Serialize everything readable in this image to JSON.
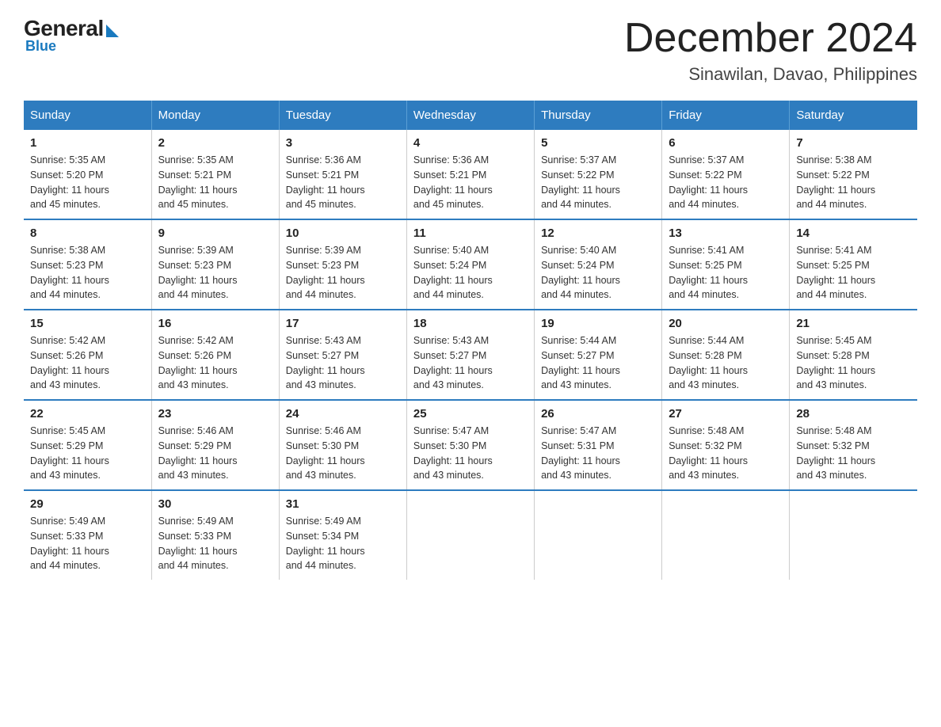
{
  "logo": {
    "general": "General",
    "blue": "Blue"
  },
  "header": {
    "month": "December 2024",
    "location": "Sinawilan, Davao, Philippines"
  },
  "weekdays": [
    "Sunday",
    "Monday",
    "Tuesday",
    "Wednesday",
    "Thursday",
    "Friday",
    "Saturday"
  ],
  "weeks": [
    [
      {
        "day": "1",
        "sunrise": "5:35 AM",
        "sunset": "5:20 PM",
        "daylight": "11 hours and 45 minutes."
      },
      {
        "day": "2",
        "sunrise": "5:35 AM",
        "sunset": "5:21 PM",
        "daylight": "11 hours and 45 minutes."
      },
      {
        "day": "3",
        "sunrise": "5:36 AM",
        "sunset": "5:21 PM",
        "daylight": "11 hours and 45 minutes."
      },
      {
        "day": "4",
        "sunrise": "5:36 AM",
        "sunset": "5:21 PM",
        "daylight": "11 hours and 45 minutes."
      },
      {
        "day": "5",
        "sunrise": "5:37 AM",
        "sunset": "5:22 PM",
        "daylight": "11 hours and 44 minutes."
      },
      {
        "day": "6",
        "sunrise": "5:37 AM",
        "sunset": "5:22 PM",
        "daylight": "11 hours and 44 minutes."
      },
      {
        "day": "7",
        "sunrise": "5:38 AM",
        "sunset": "5:22 PM",
        "daylight": "11 hours and 44 minutes."
      }
    ],
    [
      {
        "day": "8",
        "sunrise": "5:38 AM",
        "sunset": "5:23 PM",
        "daylight": "11 hours and 44 minutes."
      },
      {
        "day": "9",
        "sunrise": "5:39 AM",
        "sunset": "5:23 PM",
        "daylight": "11 hours and 44 minutes."
      },
      {
        "day": "10",
        "sunrise": "5:39 AM",
        "sunset": "5:23 PM",
        "daylight": "11 hours and 44 minutes."
      },
      {
        "day": "11",
        "sunrise": "5:40 AM",
        "sunset": "5:24 PM",
        "daylight": "11 hours and 44 minutes."
      },
      {
        "day": "12",
        "sunrise": "5:40 AM",
        "sunset": "5:24 PM",
        "daylight": "11 hours and 44 minutes."
      },
      {
        "day": "13",
        "sunrise": "5:41 AM",
        "sunset": "5:25 PM",
        "daylight": "11 hours and 44 minutes."
      },
      {
        "day": "14",
        "sunrise": "5:41 AM",
        "sunset": "5:25 PM",
        "daylight": "11 hours and 44 minutes."
      }
    ],
    [
      {
        "day": "15",
        "sunrise": "5:42 AM",
        "sunset": "5:26 PM",
        "daylight": "11 hours and 43 minutes."
      },
      {
        "day": "16",
        "sunrise": "5:42 AM",
        "sunset": "5:26 PM",
        "daylight": "11 hours and 43 minutes."
      },
      {
        "day": "17",
        "sunrise": "5:43 AM",
        "sunset": "5:27 PM",
        "daylight": "11 hours and 43 minutes."
      },
      {
        "day": "18",
        "sunrise": "5:43 AM",
        "sunset": "5:27 PM",
        "daylight": "11 hours and 43 minutes."
      },
      {
        "day": "19",
        "sunrise": "5:44 AM",
        "sunset": "5:27 PM",
        "daylight": "11 hours and 43 minutes."
      },
      {
        "day": "20",
        "sunrise": "5:44 AM",
        "sunset": "5:28 PM",
        "daylight": "11 hours and 43 minutes."
      },
      {
        "day": "21",
        "sunrise": "5:45 AM",
        "sunset": "5:28 PM",
        "daylight": "11 hours and 43 minutes."
      }
    ],
    [
      {
        "day": "22",
        "sunrise": "5:45 AM",
        "sunset": "5:29 PM",
        "daylight": "11 hours and 43 minutes."
      },
      {
        "day": "23",
        "sunrise": "5:46 AM",
        "sunset": "5:29 PM",
        "daylight": "11 hours and 43 minutes."
      },
      {
        "day": "24",
        "sunrise": "5:46 AM",
        "sunset": "5:30 PM",
        "daylight": "11 hours and 43 minutes."
      },
      {
        "day": "25",
        "sunrise": "5:47 AM",
        "sunset": "5:30 PM",
        "daylight": "11 hours and 43 minutes."
      },
      {
        "day": "26",
        "sunrise": "5:47 AM",
        "sunset": "5:31 PM",
        "daylight": "11 hours and 43 minutes."
      },
      {
        "day": "27",
        "sunrise": "5:48 AM",
        "sunset": "5:32 PM",
        "daylight": "11 hours and 43 minutes."
      },
      {
        "day": "28",
        "sunrise": "5:48 AM",
        "sunset": "5:32 PM",
        "daylight": "11 hours and 43 minutes."
      }
    ],
    [
      {
        "day": "29",
        "sunrise": "5:49 AM",
        "sunset": "5:33 PM",
        "daylight": "11 hours and 44 minutes."
      },
      {
        "day": "30",
        "sunrise": "5:49 AM",
        "sunset": "5:33 PM",
        "daylight": "11 hours and 44 minutes."
      },
      {
        "day": "31",
        "sunrise": "5:49 AM",
        "sunset": "5:34 PM",
        "daylight": "11 hours and 44 minutes."
      },
      null,
      null,
      null,
      null
    ]
  ],
  "labels": {
    "sunrise": "Sunrise:",
    "sunset": "Sunset:",
    "daylight": "Daylight:"
  }
}
